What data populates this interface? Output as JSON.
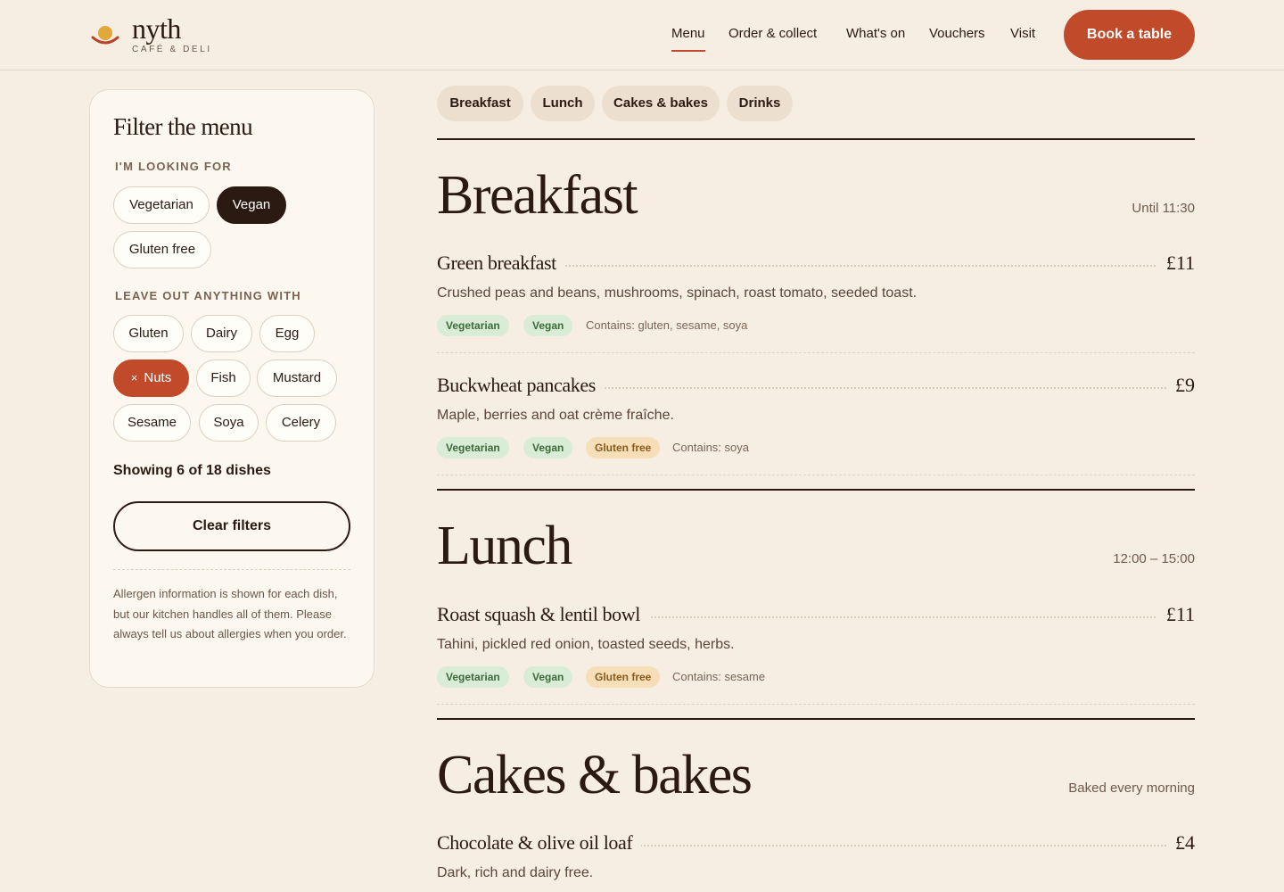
{
  "brand": {
    "name": "nyth",
    "tagline": "CAFÉ & DELI",
    "colors": {
      "accent": "#c14a2b",
      "dark": "#2b1a12",
      "background": "#f6ede3",
      "tag_green": "#d9ecd5",
      "tag_amber": "#f6dfb8"
    }
  },
  "nav": {
    "items": [
      "Menu",
      "Order & collect",
      "What's on",
      "Vouchers",
      "Visit"
    ],
    "active": "Menu",
    "cta": "Book a table"
  },
  "filter": {
    "title": "Filter the menu",
    "looking_for_label": "I'M LOOKING FOR",
    "looking_for": [
      "Vegetarian",
      "Vegan",
      "Gluten free"
    ],
    "looking_for_selected": "Vegan",
    "leave_out_label": "LEAVE OUT ANYTHING WITH",
    "leave_out": [
      "Gluten",
      "Dairy",
      "Egg",
      "Nuts",
      "Fish",
      "Mustard",
      "Sesame",
      "Soya",
      "Celery"
    ],
    "leave_out_selected": "Nuts",
    "remove_icon": "×",
    "showing": "Showing 6 of 18 dishes",
    "clear_label": "Clear filters",
    "allergen_note": "Allergen information is shown for each dish, but our kitchen handles all of them. Please always tell us about allergies when you order."
  },
  "tabs": [
    "Breakfast",
    "Lunch",
    "Cakes & bakes",
    "Drinks"
  ],
  "sections": [
    {
      "title": "Breakfast",
      "meta": "Until 11:30",
      "dishes": [
        {
          "name": "Green breakfast",
          "price": "£11",
          "desc": "Crushed peas and beans, mushrooms, spinach, roast tomato, seeded toast.",
          "tags": [
            "Vegetarian",
            "Vegan"
          ],
          "contains": "Contains: gluten, sesame, soya"
        },
        {
          "name": "Buckwheat pancakes",
          "price": "£9",
          "desc": "Maple, berries and oat crème fraîche.",
          "tags": [
            "Vegetarian",
            "Vegan",
            "Gluten free"
          ],
          "contains": "Contains: soya"
        }
      ]
    },
    {
      "title": "Lunch",
      "meta": "12:00 – 15:00",
      "dishes": [
        {
          "name": "Roast squash & lentil bowl",
          "price": "£11",
          "desc": "Tahini, pickled red onion, toasted seeds, herbs.",
          "tags": [
            "Vegetarian",
            "Vegan",
            "Gluten free"
          ],
          "contains": "Contains: sesame"
        }
      ]
    },
    {
      "title": "Cakes & bakes",
      "meta": "Baked every morning",
      "dishes": [
        {
          "name": "Chocolate & olive oil loaf",
          "price": "£4",
          "desc": "Dark, rich and dairy free."
        }
      ]
    }
  ],
  "icons": {
    "logo": "bowl-sun-logo-icon",
    "remove": "close-icon"
  }
}
